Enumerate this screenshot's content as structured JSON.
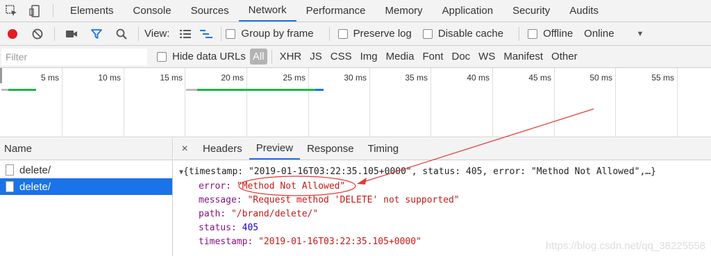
{
  "tabs": [
    "Elements",
    "Console",
    "Sources",
    "Network",
    "Performance",
    "Memory",
    "Application",
    "Security",
    "Audits"
  ],
  "toolbar": {
    "view_label": "View:",
    "group_by_frame": "Group by frame",
    "preserve_log": "Preserve log",
    "disable_cache": "Disable cache",
    "offline": "Offline",
    "throttling": "Online"
  },
  "filter": {
    "placeholder": "Filter",
    "hide_data_urls": "Hide data URLs",
    "types": [
      "All",
      "XHR",
      "JS",
      "CSS",
      "Img",
      "Media",
      "Font",
      "Doc",
      "WS",
      "Manifest",
      "Other"
    ]
  },
  "timeline": {
    "ticks": [
      "5 ms",
      "10 ms",
      "15 ms",
      "20 ms",
      "25 ms",
      "30 ms",
      "35 ms",
      "40 ms",
      "45 ms",
      "50 ms",
      "55 ms"
    ]
  },
  "requests": {
    "header": "Name",
    "items": [
      "delete/",
      "delete/"
    ]
  },
  "detail": {
    "close": "×",
    "tabs": [
      "Headers",
      "Preview",
      "Response",
      "Timing"
    ]
  },
  "preview": {
    "summary": "{timestamp: \"2019-01-16T03:22:35.105+0000\", status: 405, error: \"Method Not Allowed\",…}",
    "error_key": "error:",
    "error_val": "\"Method Not Allowed\"",
    "message_key": "message:",
    "message_val": "\"Request method 'DELETE' not supported\"",
    "path_key": "path:",
    "path_val": "\"/brand/delete/\"",
    "status_key": "status:",
    "status_val": "405",
    "timestamp_key": "timestamp:",
    "timestamp_val": "\"2019-01-16T03:22:35.105+0000\""
  },
  "watermark": "https://blog.csdn.net/qq_38225558",
  "colors": {
    "accent": "#1a73e8",
    "record": "#e51c23",
    "annotation": "#e53935"
  }
}
